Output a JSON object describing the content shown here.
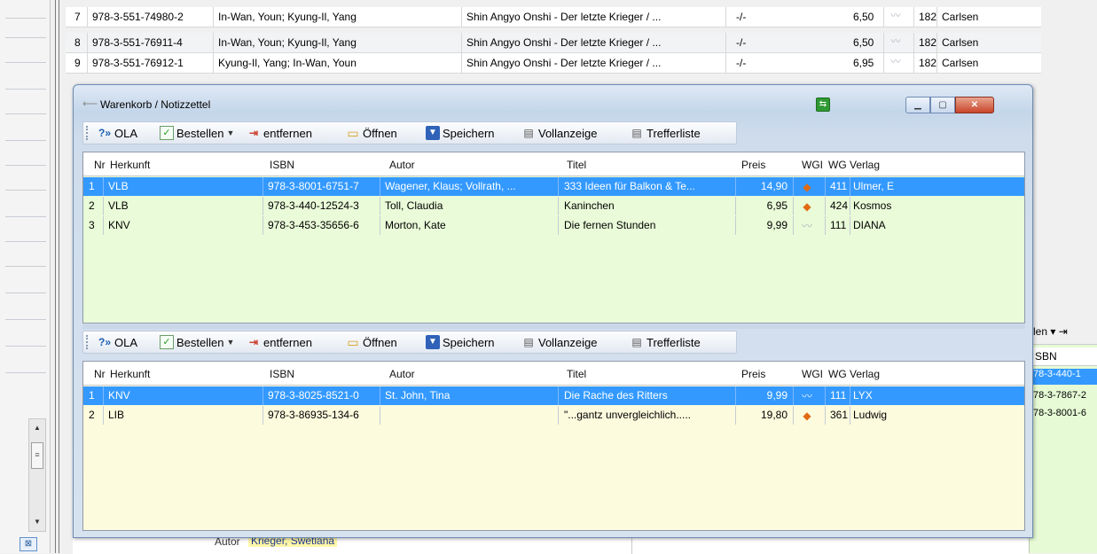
{
  "background": {
    "rows": [
      {
        "nr": "7",
        "isbn": "978-3-551-74980-2",
        "autor": "In-Wan, Youn; Kyung-Il, Yang",
        "titel": "Shin Angyo Onshi - Der letzte Krieger / ...",
        "ez": "-/-",
        "preis": "6,50",
        "wg": "182",
        "verlag": "Carlsen"
      },
      {
        "nr": "8",
        "isbn": "978-3-551-76911-4",
        "autor": "In-Wan, Youn; Kyung-Il, Yang",
        "titel": "Shin Angyo Onshi - Der letzte Krieger / ...",
        "ez": "-/-",
        "preis": "6,50",
        "wg": "182",
        "verlag": "Carlsen"
      },
      {
        "nr": "9",
        "isbn": "978-3-551-76912-1",
        "autor": "Kyung-Il, Yang; In-Wan, Youn",
        "titel": "Shin Angyo Onshi - Der letzte Krieger / ...",
        "ez": "-/-",
        "preis": "6,95",
        "wg": "182",
        "verlag": "Carlsen"
      }
    ],
    "right_panel": {
      "toolbar_text": "len ▾ ⇥",
      "header": "SBN",
      "cells": [
        "78-3-440-1",
        "78-3-7867-2",
        "78-3-8001-6"
      ]
    },
    "detail": {
      "label": "Autor",
      "value": "Krieger, Swetlana"
    }
  },
  "window": {
    "title": "Warenkorb / Notizzettel",
    "min_icon": "minimize-icon",
    "max_icon": "maximize-icon",
    "close_icon": "close-icon"
  },
  "toolbar": {
    "ola": "OLA",
    "bestellen": "Bestellen",
    "entfernen": "entfernen",
    "oeffnen": "Öffnen",
    "speichern": "Speichern",
    "vollanzeige": "Vollanzeige",
    "trefferliste": "Trefferliste"
  },
  "columns": {
    "nr": "Nr",
    "herkunft": "Herkunft",
    "isbn": "ISBN",
    "autor": "Autor",
    "titel": "Titel",
    "preis": "Preis",
    "wgi": "WGI",
    "wg": "WG",
    "verlag": "Verlag"
  },
  "cart": [
    {
      "nr": "1",
      "herkunft": "VLB",
      "isbn": "978-3-8001-6751-7",
      "autor": "Wagener, Klaus; Vollrath, ...",
      "titel": "333 Ideen für Balkon & Te...",
      "preis": "14,90",
      "wgi_icon": "book-orange-icon",
      "wg": "411",
      "verlag": "Ulmer, E"
    },
    {
      "nr": "2",
      "herkunft": "VLB",
      "isbn": "978-3-440-12524-3",
      "autor": "Toll, Claudia",
      "titel": "Kaninchen",
      "preis": "6,95",
      "wgi_icon": "book-orange-icon",
      "wg": "424",
      "verlag": "Kosmos"
    },
    {
      "nr": "3",
      "herkunft": "KNV",
      "isbn": "978-3-453-35656-6",
      "autor": "Morton, Kate",
      "titel": "Die fernen Stunden",
      "preis": "9,99",
      "wgi_icon": "book-open-icon",
      "wg": "111",
      "verlag": "DIANA"
    }
  ],
  "notes": [
    {
      "nr": "1",
      "herkunft": "KNV",
      "isbn": "978-3-8025-8521-0",
      "autor": "St. John, Tina",
      "titel": "Die Rache des Ritters",
      "preis": "9,99",
      "wgi_icon": "book-open-icon",
      "wg": "111",
      "verlag": "LYX"
    },
    {
      "nr": "2",
      "herkunft": "LIB",
      "isbn": "978-3-86935-134-6",
      "autor": "",
      "titel": "\"...gantz unvergleichlich.....",
      "preis": "19,80",
      "wgi_icon": "book-orange-icon",
      "wg": "361",
      "verlag": "Ludwig"
    }
  ]
}
